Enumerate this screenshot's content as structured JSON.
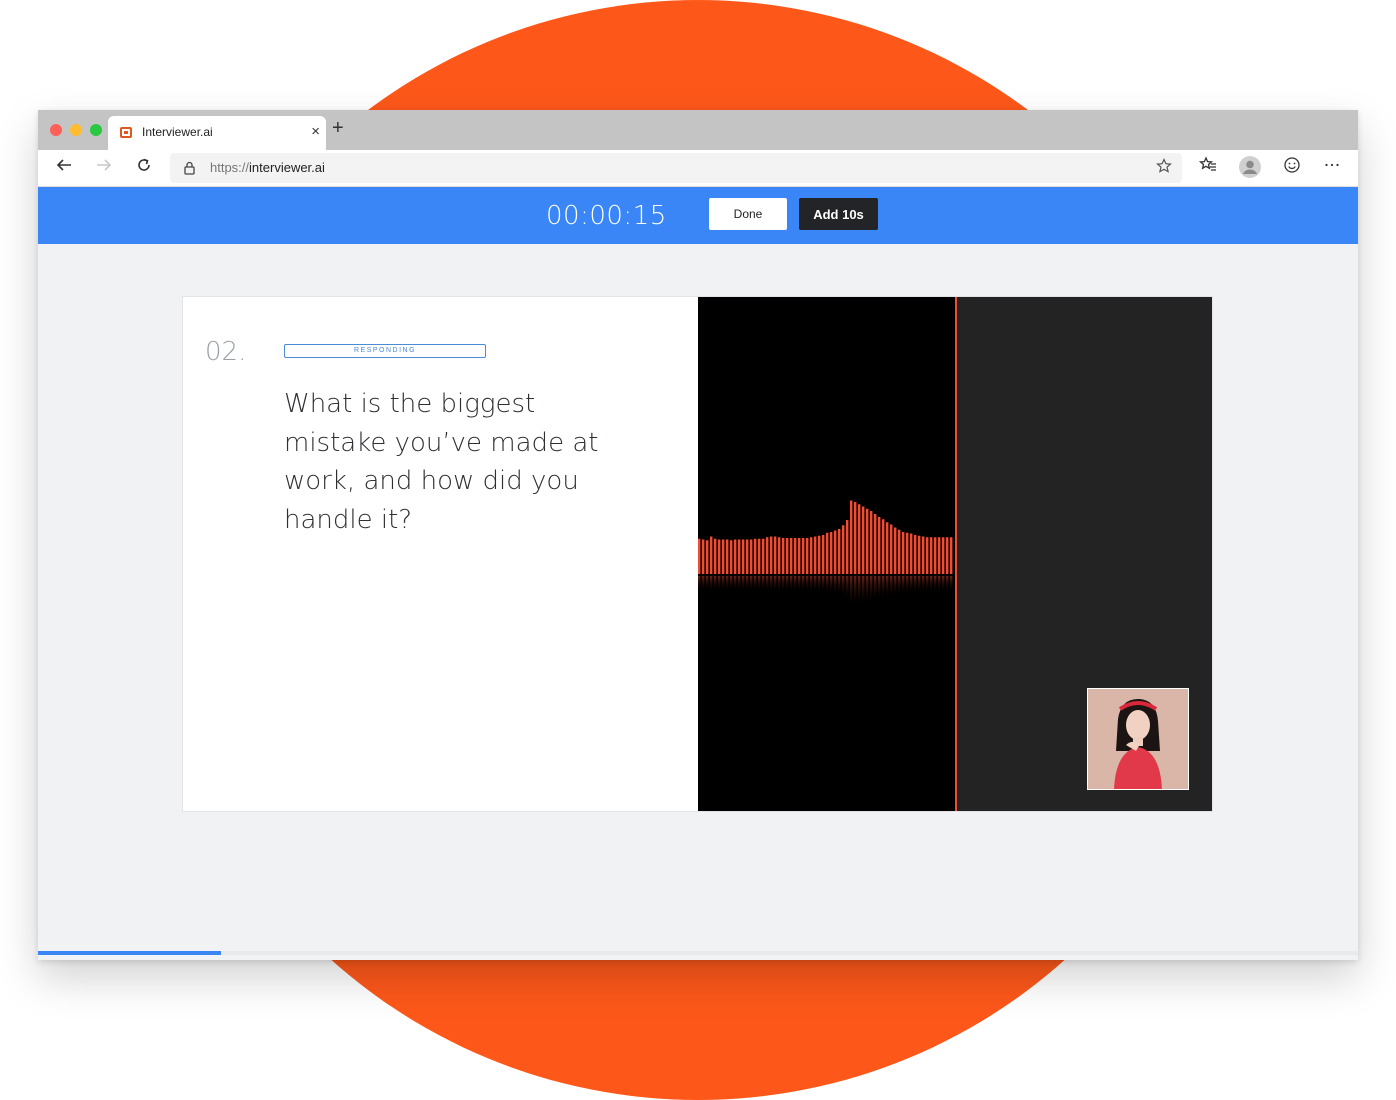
{
  "browser": {
    "tab_title": "Interviewer.ai",
    "tab_close": "×",
    "new_tab": "+",
    "url_scheme": "https://",
    "url_host": "interviewer.ai"
  },
  "toolbar": {
    "timer": "00:00:15",
    "done_label": "Done",
    "add_label": "Add 10s"
  },
  "question": {
    "number": "02.",
    "status": "RESPONDING",
    "text": "What is the biggest mistake you’ve made at work, and how did you handle it?"
  },
  "waveform": {
    "color": "#ee4e33",
    "levels": [
      0.47,
      0.46,
      0.45,
      0.5,
      0.47,
      0.46,
      0.46,
      0.46,
      0.45,
      0.46,
      0.46,
      0.46,
      0.46,
      0.46,
      0.47,
      0.47,
      0.47,
      0.49,
      0.5,
      0.5,
      0.49,
      0.48,
      0.48,
      0.48,
      0.48,
      0.48,
      0.48,
      0.48,
      0.49,
      0.5,
      0.51,
      0.52,
      0.55,
      0.56,
      0.58,
      0.6,
      0.65,
      0.72,
      0.98,
      0.96,
      0.93,
      0.9,
      0.87,
      0.84,
      0.8,
      0.76,
      0.73,
      0.69,
      0.66,
      0.62,
      0.59,
      0.56,
      0.55,
      0.54,
      0.52,
      0.51,
      0.5,
      0.49,
      0.49,
      0.49,
      0.49,
      0.49,
      0.49,
      0.49
    ]
  },
  "recording": {
    "progress": 0.139
  },
  "colors": {
    "accent": "#3b86f7",
    "brand": "#fd581a",
    "dark": "#222428"
  }
}
